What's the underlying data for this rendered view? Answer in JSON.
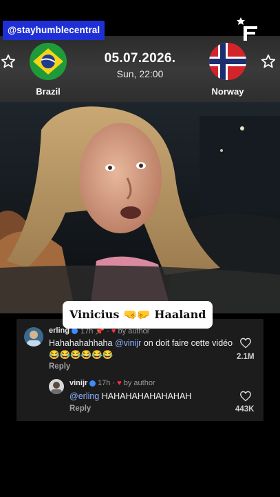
{
  "overlay": {
    "handle": "@stayhumblecentral"
  },
  "match": {
    "date": "05.07.2026.",
    "time": "Sun, 22:00",
    "home_team": "Brazil",
    "away_team": "Norway"
  },
  "caption": {
    "text": "Vinicius 🤜🤛 Haaland"
  },
  "comments": [
    {
      "user": "erling",
      "time": "17h",
      "author_tag": "by author",
      "text_prefix": "Hahahahahhaha",
      "mention": "@vinijr",
      "text_suffix": "on doit faire cette vidéo",
      "emojis": "😂😂😂😂😂😂",
      "reply_label": "Reply",
      "likes": "2.1M"
    },
    {
      "user": "vinijr",
      "time": "17h",
      "author_tag": "by author",
      "mention": "@erling",
      "text_suffix": "HAHAHAHAHAHAHAH",
      "reply_label": "Reply",
      "likes": "443K"
    }
  ],
  "colors": {
    "handle_bg": "#1f2fd6",
    "mention": "#8fb3ff",
    "heart": "#ff3040"
  },
  "icons": [
    "brand-f-star-icon",
    "star-outline-icon",
    "heart-outline-icon",
    "verified-icon",
    "pin-icon",
    "heart-filled-icon"
  ]
}
